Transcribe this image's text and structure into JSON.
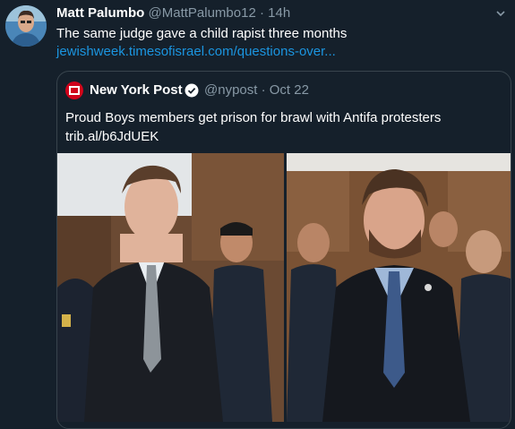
{
  "tweet": {
    "author_name": "Matt Palumbo",
    "author_handle": "@MattPalumbo12",
    "separator": "·",
    "time": "14h",
    "text": "The same judge gave a child rapist three months",
    "link_text": "jewishweek.timesofisrael.com/questions-over..."
  },
  "quoted": {
    "author_name": "New York Post",
    "author_handle": "@nypost",
    "separator": "·",
    "date": "Oct 22",
    "text": "Proud Boys members get prison for brawl with Antifa protesters trib.al/b6JdUEK",
    "logo_text": "NEW YORK POST"
  },
  "colors": {
    "background": "#15202b",
    "secondary_text": "#8899a6",
    "link": "#1b95e0",
    "border": "#38444d",
    "nypost_red": "#d0021b",
    "verified": "#ffffff"
  },
  "icons": {
    "caret": "chevron-down-icon",
    "verified": "verified-badge-icon"
  }
}
